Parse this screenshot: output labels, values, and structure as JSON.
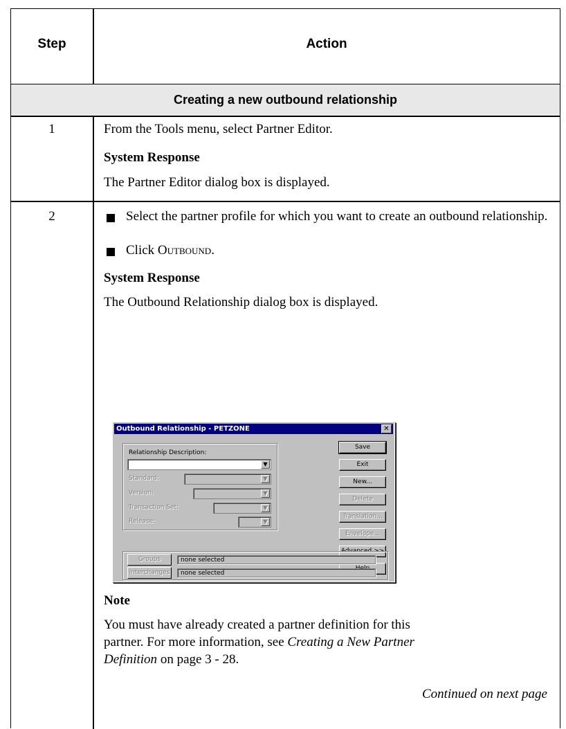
{
  "table": {
    "header_step": "Step",
    "header_action": "Action",
    "section_title": "Creating a new outbound relationship"
  },
  "steps": [
    {
      "number": "1",
      "instruction": "From the Tools menu, select Partner Editor.",
      "response_heading": "System Response",
      "response_text": "The Partner Editor dialog box is displayed."
    },
    {
      "number": "2",
      "bullets": [
        "Select the partner profile for which you want to create an outbound relationship.",
        "Click OUTBOUND."
      ],
      "bullet2_prefix": "Click ",
      "bullet2_keyword": "Outbound",
      "bullet2_suffix": ".",
      "response_heading": "System Response",
      "response_text": "The Outbound Relationship dialog box is displayed.",
      "note_heading": "Note",
      "note_line1": "You must have already created a partner definition for this",
      "note_line2_pre": "partner. For more information, see ",
      "note_link_part1": "Creating a New Partner",
      "note_link_part2": "Definition",
      "note_line3_post": " on page 3 - 28.",
      "continued": "Continued on next page"
    }
  ],
  "dialog": {
    "title": "Outbound Relationship - PETZONE",
    "close": "✕",
    "relationship_description_label": "Relationship Description:",
    "standard_label": "Standard:",
    "version_label": "Version:",
    "transaction_set_label": "Transaction Set:",
    "release_label": "Release:",
    "dropdown_arrow": "▼",
    "buttons": {
      "save": "Save",
      "exit": "Exit",
      "new": "New...",
      "delete": "Delete",
      "translation": "Translation...",
      "envelope": "Envelope...",
      "advanced": "Advanced >>",
      "help": "Help"
    },
    "groups_label": "Groups",
    "groups_value": "none selected",
    "interchanges_label": "Interchanges",
    "interchanges_value": "none selected"
  }
}
